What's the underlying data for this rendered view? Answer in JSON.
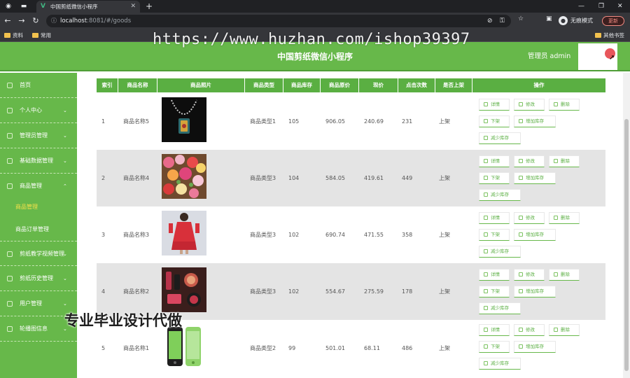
{
  "browser": {
    "tab_title": "中国剪纸微信小程序",
    "url_host": "localhost",
    "url_path": ":8081/#/goods",
    "incognito_label": "无痕模式",
    "update_label": "更新",
    "bookmarks": [
      "资料",
      "常用"
    ],
    "bookmarks_right": "其他书签"
  },
  "app": {
    "title": "中国剪纸微信小程序",
    "admin_label": "管理员 admin"
  },
  "sidebar": {
    "items": [
      {
        "label": "首页",
        "icon": "home-icon",
        "chevron": false
      },
      {
        "label": "个人中心",
        "icon": "user-icon",
        "chevron": true
      },
      {
        "label": "管理员管理",
        "icon": "admin-icon",
        "chevron": true
      },
      {
        "label": "基础数据管理",
        "icon": "data-icon",
        "chevron": true
      },
      {
        "label": "商品管理",
        "icon": "goods-icon",
        "chevron": true,
        "expanded": true
      }
    ],
    "sub_items": [
      {
        "label": "商品管理",
        "active": true
      },
      {
        "label": "商品订单管理",
        "active": false
      }
    ],
    "items_after": [
      {
        "label": "剪纸教学视频管理",
        "icon": "video-icon",
        "chevron": true
      },
      {
        "label": "剪纸历史管理",
        "icon": "history-icon",
        "chevron": true
      },
      {
        "label": "用户管理",
        "icon": "users-icon",
        "chevron": true
      },
      {
        "label": "轮播图信息",
        "icon": "carousel-icon",
        "chevron": true
      }
    ]
  },
  "table": {
    "headers": [
      "索引",
      "商品名称",
      "商品照片",
      "商品类型",
      "商品库存",
      "商品原价",
      "现价",
      "点击次数",
      "是否上架",
      "操作"
    ],
    "actions": [
      "详情",
      "修改",
      "删除",
      "下架",
      "增加库存",
      "减少库存"
    ],
    "rows": [
      {
        "index": "1",
        "name": "商品名称5",
        "photo": "necklace-photo",
        "type": "商品类型1",
        "stock": "105",
        "original_price": "906.05",
        "price": "240.69",
        "clicks": "231",
        "on_shelf": "上架"
      },
      {
        "index": "2",
        "name": "商品名称4",
        "photo": "flowers-photo",
        "type": "商品类型3",
        "stock": "104",
        "original_price": "584.05",
        "price": "419.61",
        "clicks": "449",
        "on_shelf": "上架"
      },
      {
        "index": "3",
        "name": "商品名称3",
        "photo": "red-dress-photo",
        "type": "商品类型3",
        "stock": "102",
        "original_price": "690.74",
        "price": "471.55",
        "clicks": "358",
        "on_shelf": "上架"
      },
      {
        "index": "4",
        "name": "商品名称2",
        "photo": "cosmetics-photo",
        "type": "商品类型3",
        "stock": "102",
        "original_price": "554.67",
        "price": "275.59",
        "clicks": "178",
        "on_shelf": "上架"
      },
      {
        "index": "5",
        "name": "商品名称1",
        "photo": "green-phone-photo",
        "type": "商品类型2",
        "stock": "99",
        "original_price": "501.01",
        "price": "68.11",
        "clicks": "486",
        "on_shelf": "上架"
      }
    ]
  },
  "overlays": {
    "watermark_url": "https://www.huzhan.com/ishop39397",
    "watermark_text": "专业毕业设计代做"
  },
  "colors": {
    "brand_green": "#67b84a",
    "header_green": "#5aaf42",
    "active_menu": "#f3e04a"
  }
}
